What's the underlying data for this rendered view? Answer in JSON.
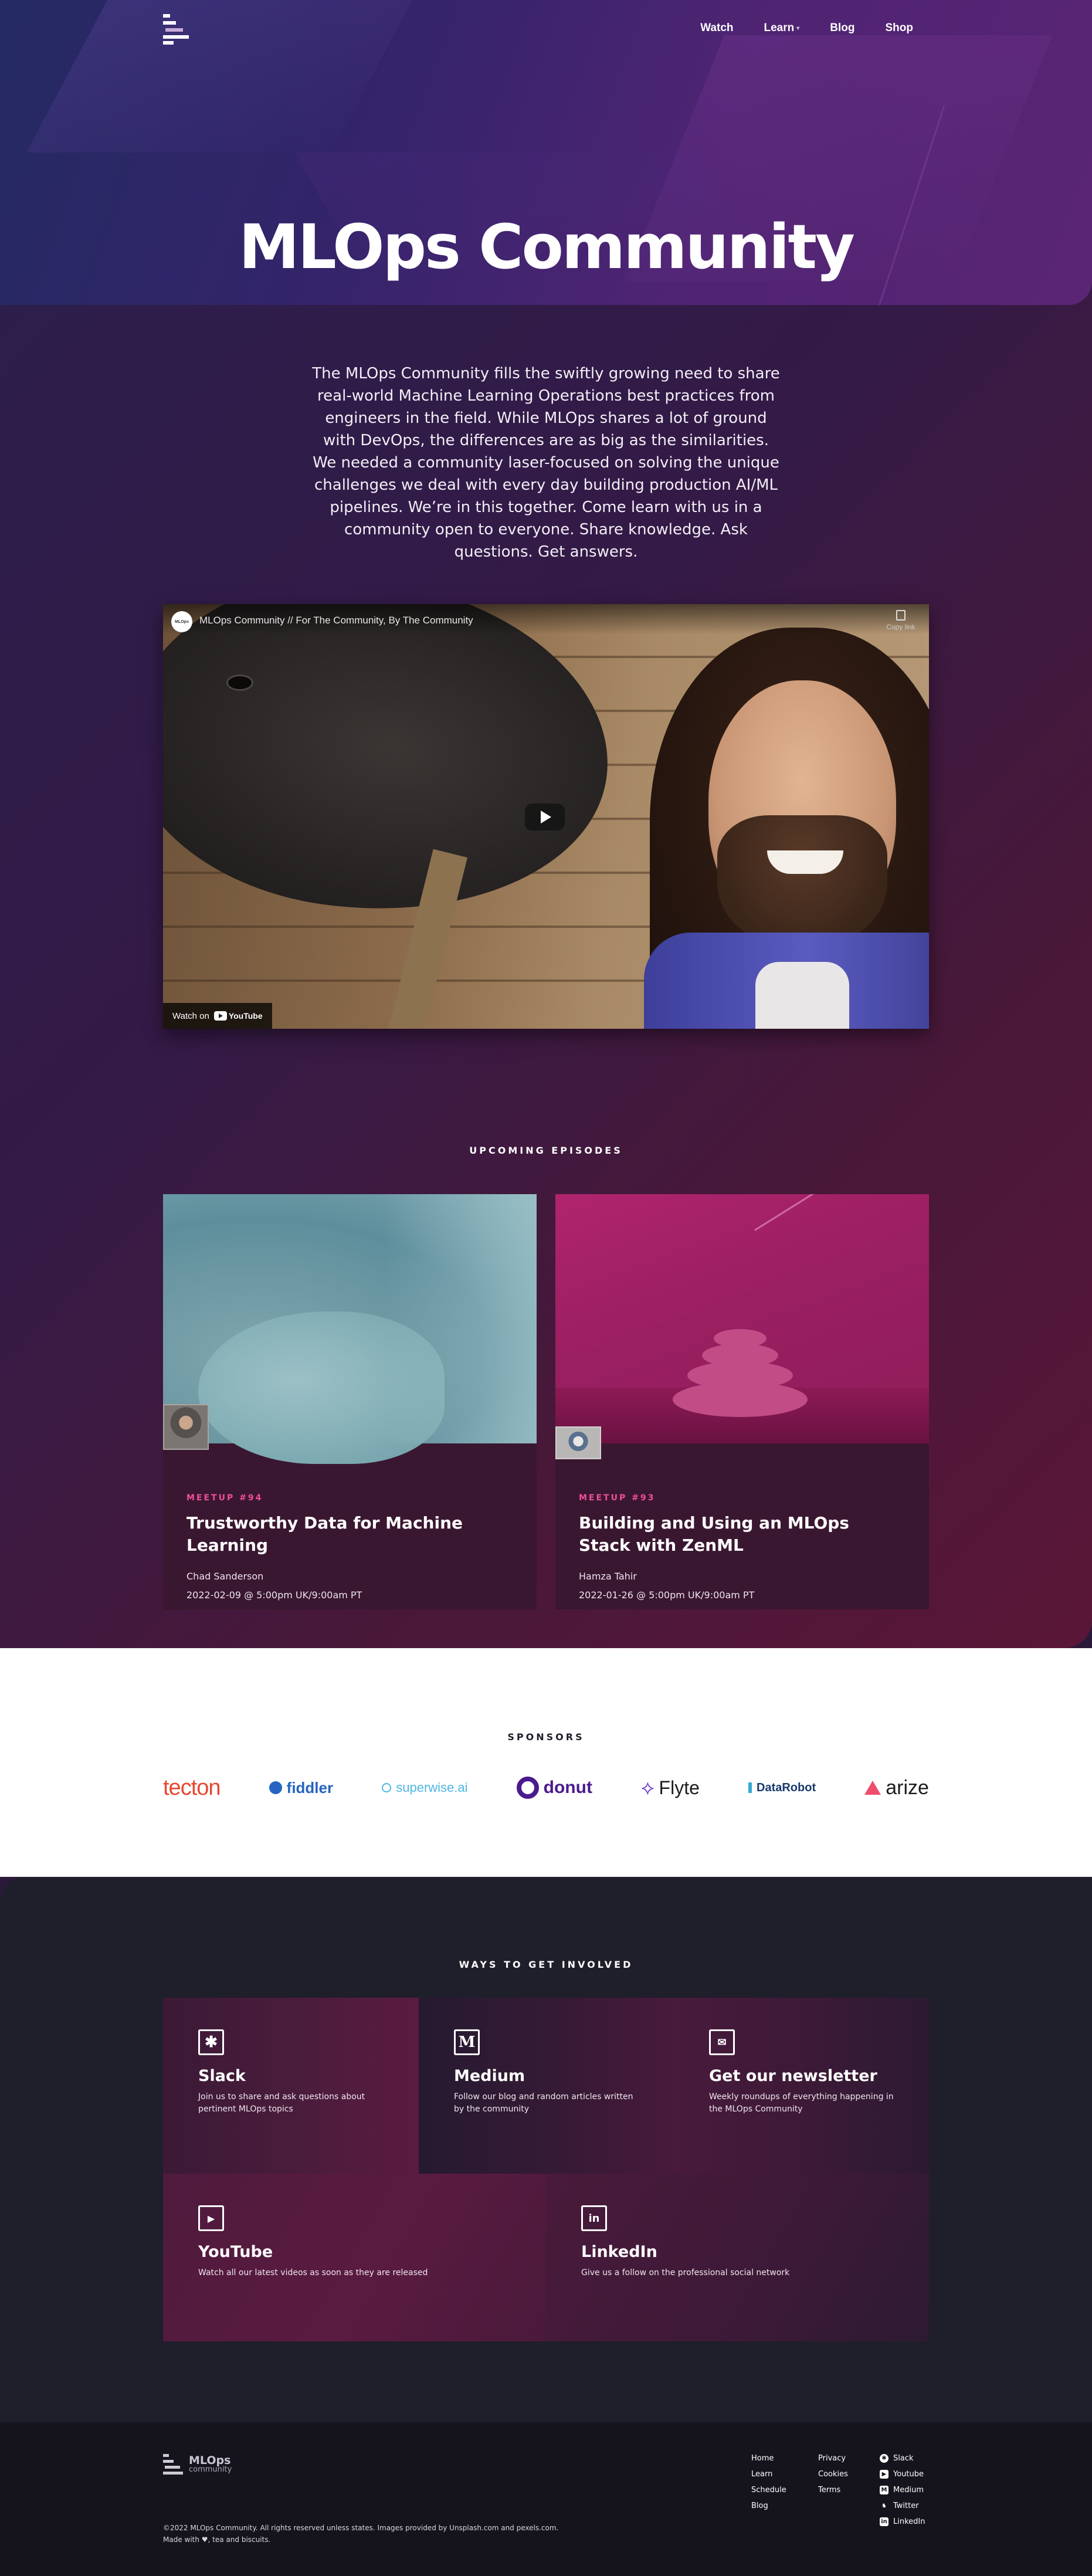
{
  "nav": {
    "items": [
      {
        "label": "Watch"
      },
      {
        "label": "Learn",
        "has_dropdown": true
      },
      {
        "label": "Blog"
      },
      {
        "label": "Shop"
      }
    ]
  },
  "hero": {
    "title": "MLOps Community",
    "intro": "The MLOps Community fills the swiftly growing need to share real-world Machine Learning Operations best practices from engineers in the field. While MLOps shares a lot of ground with DevOps, the differences are as big as the similarities. We needed a community laser-focused on solving the unique challenges we deal with every day building production AI/ML pipelines. We’re in this together. Come learn with us in a community open to everyone. Share knowledge. Ask questions. Get answers."
  },
  "video": {
    "title": "MLOps Community // For The Community, By The Community",
    "copy_label": "Copy link",
    "watch_on": "Watch on",
    "youtube": "YouTube"
  },
  "episodes": {
    "heading": "UPCOMING EPISODES",
    "items": [
      {
        "kicker": "MEETUP #94",
        "title": "Trustworthy Data for Machine Learning",
        "speaker": "Chad Sanderson",
        "date": "2022-02-09 @ 5:00pm UK/9:00am PT"
      },
      {
        "kicker": "MEETUP #93",
        "title": "Building and Using an MLOps Stack with ZenML",
        "speaker": "Hamza Tahir",
        "date": "2022-01-26 @ 5:00pm UK/9:00am PT"
      }
    ]
  },
  "sponsors": {
    "heading": "SPONSORS",
    "items": [
      {
        "name": "tecton",
        "color": "#e8472f"
      },
      {
        "name": "fiddler",
        "color": "#2564c0"
      },
      {
        "name": "superwise.ai",
        "color": "#4fb6e6"
      },
      {
        "name": "donut",
        "color": "#4b1a8c"
      },
      {
        "name": "Flyte",
        "color": "#6a3ad0"
      },
      {
        "name": "DataRobot",
        "color": "#1a3a6c"
      },
      {
        "name": "arize",
        "color": "#1c1c1c"
      }
    ]
  },
  "involved": {
    "heading": "WAYS TO GET INVOLVED",
    "items": [
      {
        "icon": "slack-icon",
        "title": "Slack",
        "desc": "Join us to share and ask questions about pertinent MLOps topics"
      },
      {
        "icon": "medium-icon",
        "title": "Medium",
        "desc": "Follow our blog and random articles written by the community"
      },
      {
        "icon": "newsletter-icon",
        "title": "Get our newsletter",
        "desc": "Weekly roundups of everything happening in the MLOps Community"
      },
      {
        "icon": "youtube-icon",
        "title": "YouTube",
        "desc": "Watch all our latest videos as soon as they are released"
      },
      {
        "icon": "linkedin-icon",
        "title": "LinkedIn",
        "desc": "Give us a follow on the professional social network"
      }
    ]
  },
  "footer": {
    "logo_line1": "MLOps",
    "logo_line2": "community",
    "col1": [
      "Home",
      "Learn",
      "Schedule",
      "Blog"
    ],
    "col2": [
      "Privacy",
      "Cookies",
      "Terms"
    ],
    "social": [
      "Slack",
      "Youtube",
      "Medium",
      "Twitter",
      "LinkedIn"
    ],
    "copyright": "©2022 MLOps Community. All rights reserved unless states. Images provided by Unsplash.com and pexels.com.",
    "made_with": "Made with ♥, tea and biscuits."
  },
  "colors": {
    "accent": "#ef4f9b",
    "hero_top": "#34246a",
    "hero_body": "#4a1838",
    "involved_bg": "#1f1e2b",
    "footer_bg": "#15141d"
  }
}
